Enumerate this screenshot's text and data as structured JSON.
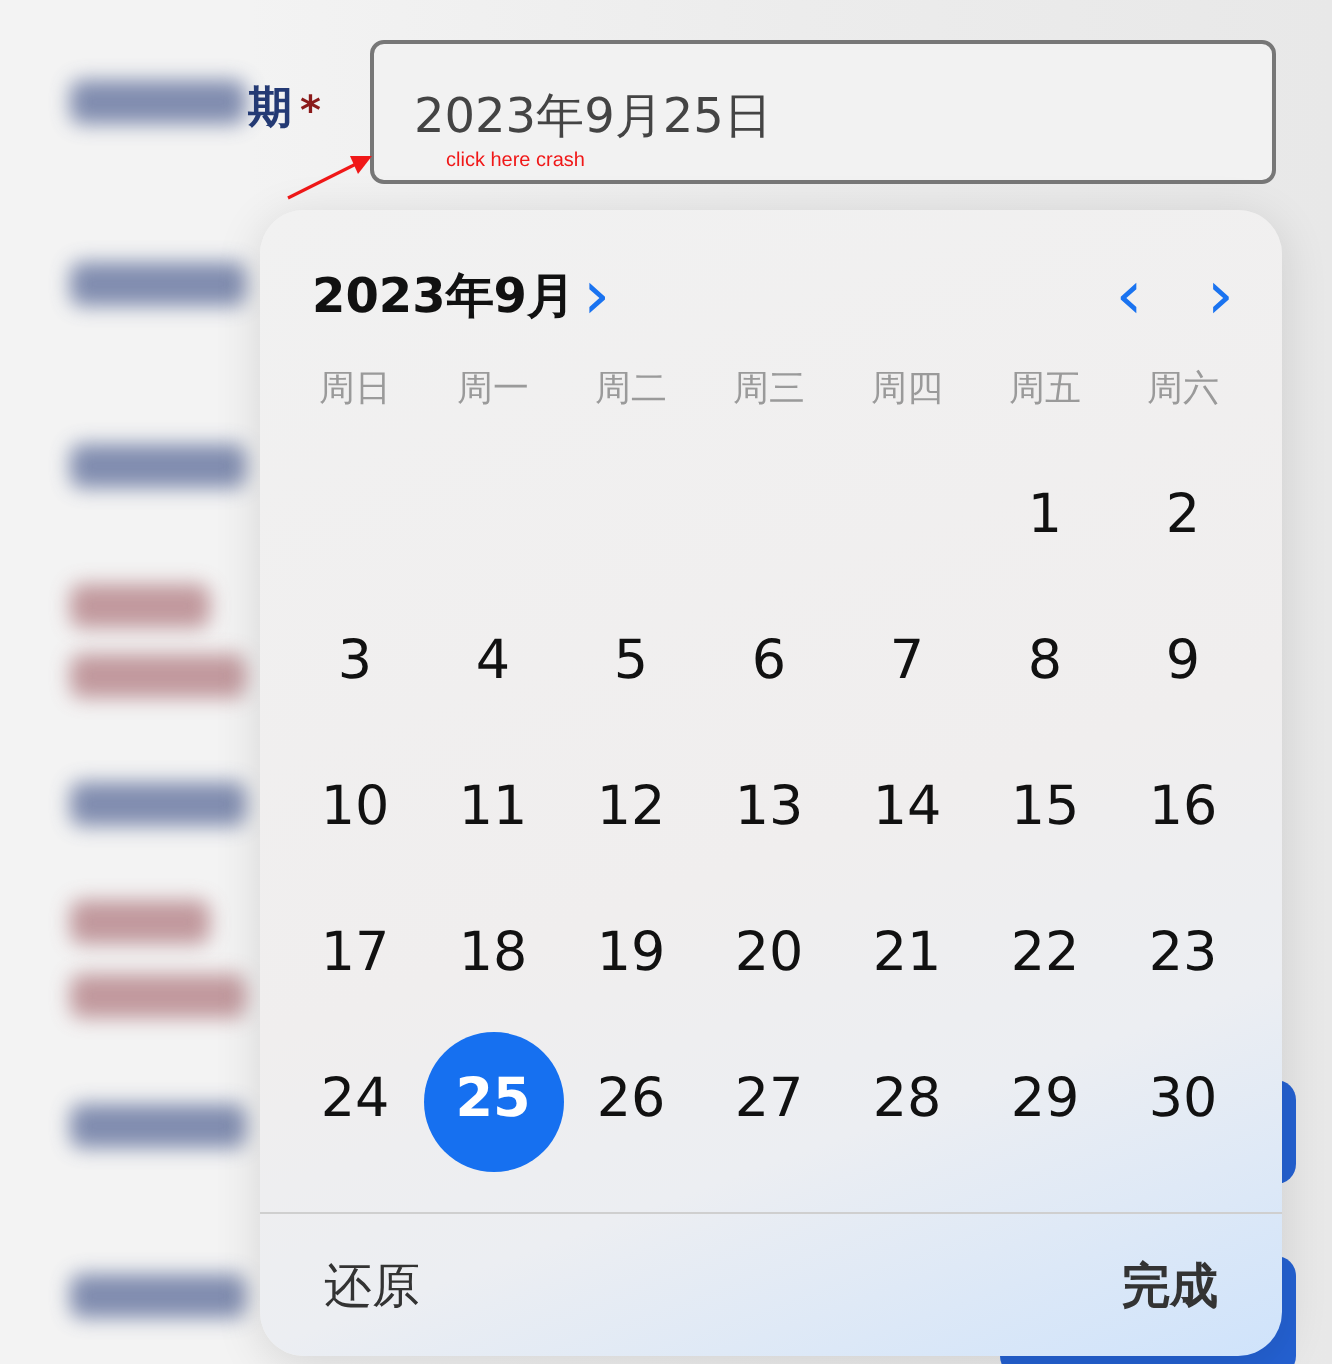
{
  "form": {
    "label_tail": "期",
    "required_mark": "*",
    "date_field": {
      "value": "2023年9月25日"
    },
    "annotation": "click here crash",
    "blurred_labels": [
      {
        "kind": "label"
      },
      {
        "kind": "label"
      },
      {
        "kind": "label"
      },
      {
        "kind": "error"
      },
      {
        "kind": "error"
      },
      {
        "kind": "label"
      },
      {
        "kind": "error"
      },
      {
        "kind": "error"
      },
      {
        "kind": "label"
      },
      {
        "kind": "label"
      }
    ]
  },
  "picker": {
    "month_title": "2023年9月",
    "month_chevron": "›",
    "prev": "‹",
    "next": "›",
    "weekdays": [
      "周日",
      "周一",
      "周二",
      "周三",
      "周四",
      "周五",
      "周六"
    ],
    "weeks": [
      [
        {
          "kind": "empty"
        },
        {
          "kind": "empty"
        },
        {
          "kind": "empty"
        },
        {
          "kind": "empty"
        },
        {
          "kind": "empty"
        },
        {
          "label": "1",
          "selected": false
        },
        {
          "label": "2",
          "selected": false
        }
      ],
      [
        {
          "label": "3",
          "selected": false
        },
        {
          "label": "4",
          "selected": false
        },
        {
          "label": "5",
          "selected": false
        },
        {
          "label": "6",
          "selected": false
        },
        {
          "label": "7",
          "selected": false
        },
        {
          "label": "8",
          "selected": false
        },
        {
          "label": "9",
          "selected": false
        }
      ],
      [
        {
          "label": "10",
          "selected": false
        },
        {
          "label": "11",
          "selected": false
        },
        {
          "label": "12",
          "selected": false
        },
        {
          "label": "13",
          "selected": false
        },
        {
          "label": "14",
          "selected": false
        },
        {
          "label": "15",
          "selected": false
        },
        {
          "label": "16",
          "selected": false
        }
      ],
      [
        {
          "label": "17",
          "selected": false
        },
        {
          "label": "18",
          "selected": false
        },
        {
          "label": "19",
          "selected": false
        },
        {
          "label": "20",
          "selected": false
        },
        {
          "label": "21",
          "selected": false
        },
        {
          "label": "22",
          "selected": false
        },
        {
          "label": "23",
          "selected": false
        }
      ],
      [
        {
          "label": "24",
          "selected": false
        },
        {
          "label": "25",
          "selected": true
        },
        {
          "label": "26",
          "selected": false
        },
        {
          "label": "27",
          "selected": false
        },
        {
          "label": "28",
          "selected": false
        },
        {
          "label": "29",
          "selected": false
        },
        {
          "label": "30",
          "selected": false
        }
      ]
    ],
    "reset": "还原",
    "done": "完成"
  }
}
